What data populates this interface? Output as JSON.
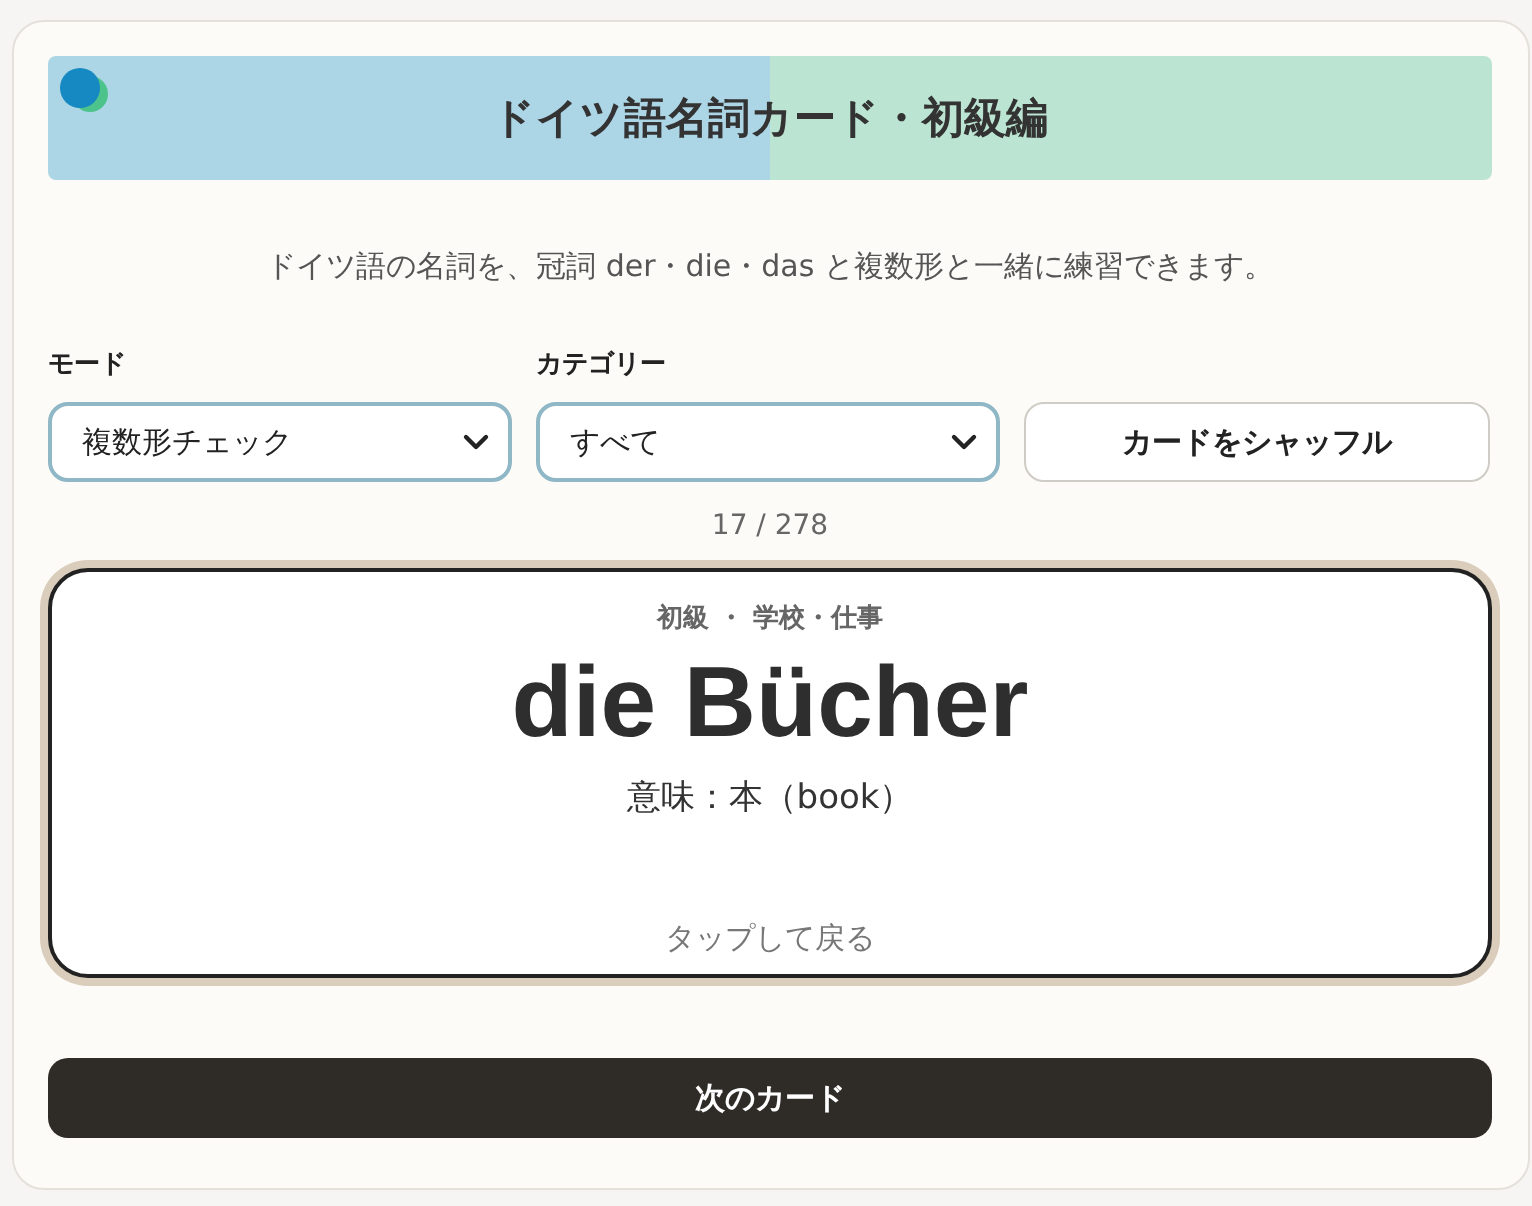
{
  "header": {
    "title": "ドイツ語名詞カード・初級編"
  },
  "description": "ドイツ語の名詞を、冠詞 der・die・das と複数形と一緒に練習できます。",
  "controls": {
    "mode": {
      "label": "モード",
      "value": "複数形チェック"
    },
    "category": {
      "label": "カテゴリー",
      "value": "すべて"
    },
    "shuffle_button": "カードをシャッフル"
  },
  "counter": "17 / 278",
  "card": {
    "tags": "初級 ・ 学校・仕事",
    "word": "die Bücher",
    "meaning": "意味：本（book）",
    "hint": "タップして戻る"
  },
  "next_button": "次のカード"
}
